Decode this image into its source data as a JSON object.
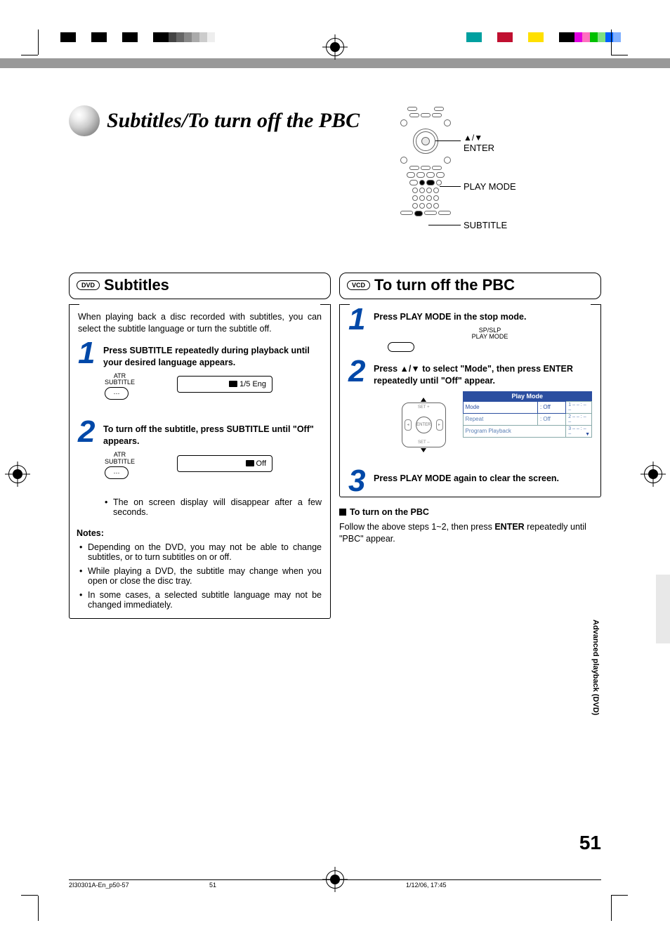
{
  "header": {
    "page_title": "Subtitles/To turn off the PBC"
  },
  "remote_labels": {
    "enter": "ENTER",
    "enter_sym": "▲/▼",
    "play_mode": "PLAY MODE",
    "subtitle": "SUBTITLE"
  },
  "left": {
    "badge": "DVD",
    "title": "Subtitles",
    "intro": "When playing back a disc recorded with subtitles, you can select the subtitle language or turn the subtitle off.",
    "step1": {
      "text": "Press SUBTITLE repeatedly during playback until your desired language appears.",
      "btn_line1": "ATR",
      "btn_line2": "SUBTITLE",
      "btn_symbol": "⋯",
      "osd": "1/5 Eng"
    },
    "step2": {
      "text": "To turn off the subtitle, press SUBTITLE until \"Off\" appears.",
      "btn_line1": "ATR",
      "btn_line2": "SUBTITLE",
      "btn_symbol": "⋯",
      "osd": "Off",
      "note": "The on screen display will disappear after a few seconds."
    },
    "notes_header": "Notes:",
    "notes": [
      "Depending on the DVD, you may not be able to change subtitles, or to turn subtitles on or off.",
      "While playing a DVD, the subtitle may change when you open or close the disc tray.",
      "In some cases, a selected subtitle language may not be changed immediately."
    ]
  },
  "right": {
    "badge": "VCD",
    "title": "To turn off the PBC",
    "step1": {
      "text": "Press PLAY MODE in the stop mode.",
      "btn_line1": "SP/SLP",
      "btn_line2": "PLAY MODE"
    },
    "step2": {
      "text_pre": "Press ",
      "text_arrows": "▲/▼",
      "text_mid": " to select \"Mode\", then press ENTER repeatedly until \"Off\" appear.",
      "dpad": {
        "set_plus": "SET +",
        "set_minus": "SET –",
        "enter": "ENTER"
      },
      "menu": {
        "title": "Play Mode",
        "rows": [
          {
            "k": "Mode",
            "v": ": Off",
            "selected": true
          },
          {
            "k": "Repeat",
            "v": ": Off",
            "selected": false
          },
          {
            "k": "Program Playback",
            "v": "",
            "selected": false
          }
        ],
        "side_nums": [
          "1    – – : – –",
          "2    – – : – –",
          "3    – – : – –"
        ]
      }
    },
    "step3": {
      "text": "Press PLAY MODE again to clear the screen."
    },
    "turn_on_hdr": "To turn on the PBC",
    "turn_on_text_pre": "Follow the above steps 1~2, then press ",
    "turn_on_text_bold": "ENTER",
    "turn_on_text_post": " repeatedly until \"PBC\" appear."
  },
  "side_tab": "Advanced playback (DVD)",
  "page_number": "51",
  "footer": {
    "doc": "2I30301A-En_p50-57",
    "pg": "51",
    "ts": "1/12/06, 17:45"
  }
}
